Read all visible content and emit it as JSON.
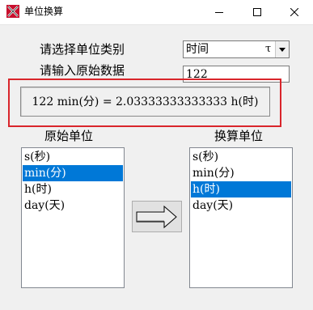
{
  "window": {
    "title": "单位换算"
  },
  "form": {
    "category_label": "请选择单位类别",
    "input_label": "请输入原始数据",
    "category_value": "时间",
    "category_extra_glyph": "τ",
    "input_value": "122"
  },
  "result": {
    "text": "122 min(分) = 2.03333333333333 h(时)"
  },
  "source": {
    "label": "原始单位",
    "items": [
      "s(秒)",
      "min(分)",
      "h(时)",
      "day(天)"
    ],
    "selected_index": 1
  },
  "target": {
    "label": "换算单位",
    "items": [
      "s(秒)",
      "min(分)",
      "h(时)",
      "day(天)"
    ],
    "selected_index": 2
  },
  "colors": {
    "selection": "#0078d7",
    "annotation": "#d9252b",
    "app_icon": "#c8102e"
  }
}
